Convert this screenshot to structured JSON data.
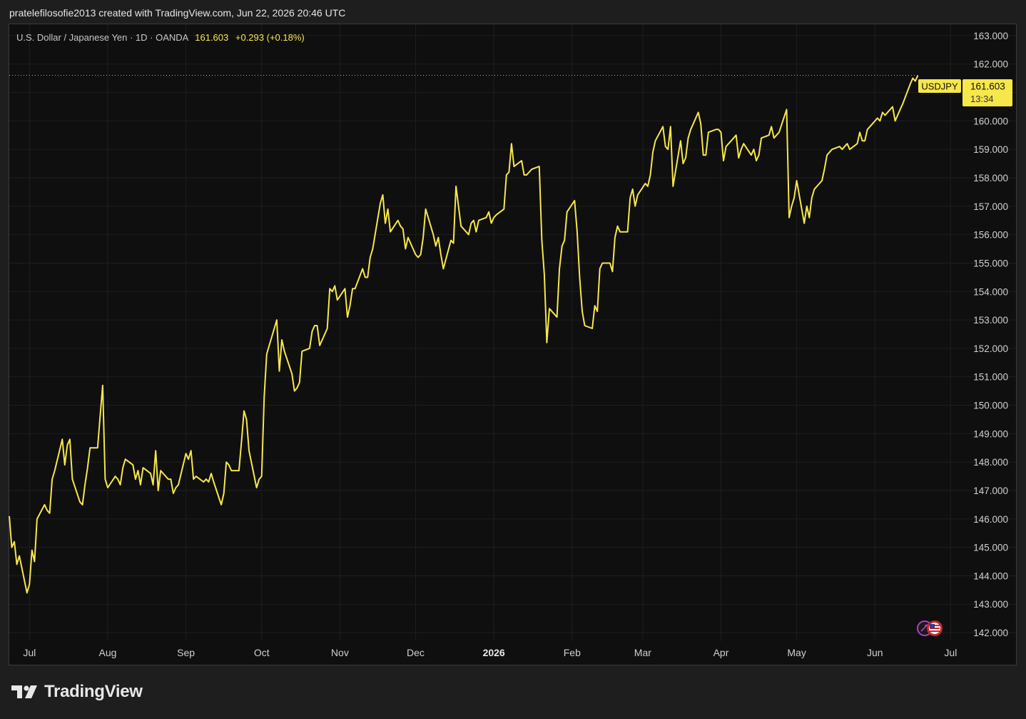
{
  "header": {
    "text": "pratelefilosofie2013 created with TradingView.com, Jun 22, 2026 20:46 UTC"
  },
  "legend": {
    "symbol_text": "U.S. Dollar / Japanese Yen · 1D · OANDA",
    "last": "161.603",
    "change": "+0.293 (+0.18%)"
  },
  "price_label": {
    "symbol": "USDJPY",
    "price": "161.603",
    "countdown": "13:34"
  },
  "brand": {
    "name": "TradingView"
  },
  "colors": {
    "line": "#f6e74a",
    "background": "#0f0f0f",
    "page": "#1e1e1e",
    "grid": "#1f1f1f"
  },
  "icons": [
    "tradingview-logo-icon",
    "us-flag-icon",
    "events-icon"
  ],
  "chart_data": {
    "type": "line",
    "title": "U.S. Dollar / Japanese Yen · 1D · OANDA",
    "series_name": "USDJPY",
    "ylim": [
      141.7,
      163.4
    ],
    "y_ticks": [
      "163.000",
      "162.000",
      "161.000",
      "160.000",
      "159.000",
      "158.000",
      "157.000",
      "156.000",
      "155.000",
      "154.000",
      "153.000",
      "152.000",
      "151.000",
      "150.000",
      "149.000",
      "148.000",
      "147.000",
      "146.000",
      "145.000",
      "144.000",
      "143.000",
      "142.000"
    ],
    "x_ticks": [
      {
        "label": "Jul",
        "date": "2025-07-01"
      },
      {
        "label": "Aug",
        "date": "2025-08-01"
      },
      {
        "label": "Sep",
        "date": "2025-09-01"
      },
      {
        "label": "Oct",
        "date": "2025-10-01"
      },
      {
        "label": "Nov",
        "date": "2025-11-01"
      },
      {
        "label": "Dec",
        "date": "2025-12-01"
      },
      {
        "label": "2026",
        "date": "2026-01-01",
        "bold": true
      },
      {
        "label": "Feb",
        "date": "2026-02-01"
      },
      {
        "label": "Mar",
        "date": "2026-03-01"
      },
      {
        "label": "Apr",
        "date": "2026-04-01"
      },
      {
        "label": "May",
        "date": "2026-05-01"
      },
      {
        "label": "Jun",
        "date": "2026-06-01"
      },
      {
        "label": "Jul",
        "date": "2026-07-01"
      }
    ],
    "x_range": [
      "2025-06-23",
      "2026-07-04"
    ],
    "grid": true,
    "points": [
      [
        "2025-06-23",
        146.1
      ],
      [
        "2025-06-24",
        145.0
      ],
      [
        "2025-06-25",
        145.2
      ],
      [
        "2025-06-26",
        144.4
      ],
      [
        "2025-06-27",
        144.7
      ],
      [
        "2025-06-30",
        143.4
      ],
      [
        "2025-07-01",
        143.7
      ],
      [
        "2025-07-02",
        144.9
      ],
      [
        "2025-07-03",
        144.5
      ],
      [
        "2025-07-04",
        146.0
      ],
      [
        "2025-07-07",
        146.5
      ],
      [
        "2025-07-08",
        146.3
      ],
      [
        "2025-07-09",
        146.2
      ],
      [
        "2025-07-10",
        147.4
      ],
      [
        "2025-07-11",
        147.7
      ],
      [
        "2025-07-14",
        148.8
      ],
      [
        "2025-07-15",
        147.9
      ],
      [
        "2025-07-16",
        148.6
      ],
      [
        "2025-07-17",
        148.8
      ],
      [
        "2025-07-18",
        147.4
      ],
      [
        "2025-07-21",
        146.6
      ],
      [
        "2025-07-22",
        146.5
      ],
      [
        "2025-07-23",
        147.2
      ],
      [
        "2025-07-24",
        147.8
      ],
      [
        "2025-07-25",
        148.5
      ],
      [
        "2025-07-28",
        148.5
      ],
      [
        "2025-07-29",
        149.6
      ],
      [
        "2025-07-30",
        150.7
      ],
      [
        "2025-07-31",
        147.4
      ],
      [
        "2025-08-01",
        147.1
      ],
      [
        "2025-08-04",
        147.5
      ],
      [
        "2025-08-05",
        147.4
      ],
      [
        "2025-08-06",
        147.2
      ],
      [
        "2025-08-07",
        147.8
      ],
      [
        "2025-08-08",
        148.1
      ],
      [
        "2025-08-11",
        147.9
      ],
      [
        "2025-08-12",
        147.4
      ],
      [
        "2025-08-13",
        147.7
      ],
      [
        "2025-08-14",
        147.2
      ],
      [
        "2025-08-15",
        147.8
      ],
      [
        "2025-08-18",
        147.6
      ],
      [
        "2025-08-19",
        147.2
      ],
      [
        "2025-08-20",
        148.4
      ],
      [
        "2025-08-21",
        147.0
      ],
      [
        "2025-08-22",
        147.7
      ],
      [
        "2025-08-25",
        147.4
      ],
      [
        "2025-08-26",
        147.4
      ],
      [
        "2025-08-27",
        146.9
      ],
      [
        "2025-08-28",
        147.1
      ],
      [
        "2025-08-29",
        147.2
      ],
      [
        "2025-09-01",
        148.3
      ],
      [
        "2025-09-02",
        148.1
      ],
      [
        "2025-09-03",
        148.4
      ],
      [
        "2025-09-04",
        147.4
      ],
      [
        "2025-09-05",
        147.5
      ],
      [
        "2025-09-08",
        147.3
      ],
      [
        "2025-09-09",
        147.4
      ],
      [
        "2025-09-10",
        147.3
      ],
      [
        "2025-09-11",
        147.6
      ],
      [
        "2025-09-12",
        147.3
      ],
      [
        "2025-09-15",
        146.5
      ],
      [
        "2025-09-16",
        146.9
      ],
      [
        "2025-09-17",
        148.0
      ],
      [
        "2025-09-18",
        147.9
      ],
      [
        "2025-09-19",
        147.7
      ],
      [
        "2025-09-22",
        147.7
      ],
      [
        "2025-09-23",
        148.7
      ],
      [
        "2025-09-24",
        149.8
      ],
      [
        "2025-09-25",
        149.5
      ],
      [
        "2025-09-26",
        148.4
      ],
      [
        "2025-09-29",
        147.1
      ],
      [
        "2025-09-30",
        147.4
      ],
      [
        "2025-10-01",
        147.5
      ],
      [
        "2025-10-02",
        150.3
      ],
      [
        "2025-10-03",
        151.8
      ],
      [
        "2025-10-06",
        152.7
      ],
      [
        "2025-10-07",
        153.0
      ],
      [
        "2025-10-08",
        151.2
      ],
      [
        "2025-10-09",
        152.3
      ],
      [
        "2025-10-10",
        151.9
      ],
      [
        "2025-10-13",
        151.1
      ],
      [
        "2025-10-14",
        150.5
      ],
      [
        "2025-10-15",
        150.6
      ],
      [
        "2025-10-16",
        150.8
      ],
      [
        "2025-10-17",
        151.9
      ],
      [
        "2025-10-20",
        152.0
      ],
      [
        "2025-10-21",
        152.6
      ],
      [
        "2025-10-22",
        152.8
      ],
      [
        "2025-10-23",
        152.8
      ],
      [
        "2025-10-24",
        152.1
      ],
      [
        "2025-10-27",
        152.7
      ],
      [
        "2025-10-28",
        154.1
      ],
      [
        "2025-10-29",
        154.0
      ],
      [
        "2025-10-30",
        154.2
      ],
      [
        "2025-10-31",
        153.7
      ],
      [
        "2025-11-03",
        154.1
      ],
      [
        "2025-11-04",
        153.1
      ],
      [
        "2025-11-05",
        153.5
      ],
      [
        "2025-11-06",
        154.1
      ],
      [
        "2025-11-07",
        154.1
      ],
      [
        "2025-11-10",
        154.8
      ],
      [
        "2025-11-11",
        154.5
      ],
      [
        "2025-11-12",
        154.5
      ],
      [
        "2025-11-13",
        155.2
      ],
      [
        "2025-11-14",
        155.5
      ],
      [
        "2025-11-17",
        157.1
      ],
      [
        "2025-11-18",
        157.4
      ],
      [
        "2025-11-19",
        156.4
      ],
      [
        "2025-11-20",
        156.9
      ],
      [
        "2025-11-21",
        156.1
      ],
      [
        "2025-11-24",
        156.5
      ],
      [
        "2025-11-25",
        156.3
      ],
      [
        "2025-11-26",
        156.2
      ],
      [
        "2025-11-27",
        155.5
      ],
      [
        "2025-11-28",
        155.9
      ],
      [
        "2025-12-01",
        155.3
      ],
      [
        "2025-12-02",
        155.2
      ],
      [
        "2025-12-03",
        155.3
      ],
      [
        "2025-12-04",
        155.9
      ],
      [
        "2025-12-05",
        156.9
      ],
      [
        "2025-12-08",
        156.0
      ],
      [
        "2025-12-09",
        155.6
      ],
      [
        "2025-12-10",
        155.9
      ],
      [
        "2025-12-11",
        155.3
      ],
      [
        "2025-12-12",
        154.8
      ],
      [
        "2025-12-15",
        155.8
      ],
      [
        "2025-12-16",
        155.7
      ],
      [
        "2025-12-17",
        157.7
      ],
      [
        "2025-12-18",
        157.0
      ],
      [
        "2025-12-19",
        156.3
      ],
      [
        "2025-12-22",
        156.0
      ],
      [
        "2025-12-23",
        156.4
      ],
      [
        "2025-12-24",
        156.5
      ],
      [
        "2025-12-25",
        156.1
      ],
      [
        "2025-12-26",
        156.5
      ],
      [
        "2025-12-29",
        156.6
      ],
      [
        "2025-12-30",
        156.8
      ],
      [
        "2025-12-31",
        156.4
      ],
      [
        "2026-01-01",
        156.6
      ],
      [
        "2026-01-02",
        156.7
      ],
      [
        "2026-01-05",
        156.9
      ],
      [
        "2026-01-06",
        158.1
      ],
      [
        "2026-01-07",
        158.2
      ],
      [
        "2026-01-08",
        159.2
      ],
      [
        "2026-01-09",
        158.4
      ],
      [
        "2026-01-12",
        158.6
      ],
      [
        "2026-01-13",
        158.1
      ],
      [
        "2026-01-14",
        158.1
      ],
      [
        "2026-01-15",
        158.2
      ],
      [
        "2026-01-16",
        158.3
      ],
      [
        "2026-01-19",
        158.4
      ],
      [
        "2026-01-20",
        155.8
      ],
      [
        "2026-01-21",
        154.6
      ],
      [
        "2026-01-22",
        152.2
      ],
      [
        "2026-01-23",
        153.4
      ],
      [
        "2026-01-26",
        153.1
      ],
      [
        "2026-01-27",
        154.8
      ],
      [
        "2026-01-28",
        155.6
      ],
      [
        "2026-01-29",
        155.8
      ],
      [
        "2026-01-30",
        156.8
      ],
      [
        "2026-02-02",
        157.2
      ],
      [
        "2026-02-03",
        156.1
      ],
      [
        "2026-02-04",
        154.5
      ],
      [
        "2026-02-05",
        153.3
      ],
      [
        "2026-02-06",
        152.8
      ],
      [
        "2026-02-09",
        152.7
      ],
      [
        "2026-02-10",
        153.5
      ],
      [
        "2026-02-11",
        153.3
      ],
      [
        "2026-02-12",
        154.8
      ],
      [
        "2026-02-13",
        155.0
      ],
      [
        "2026-02-16",
        155.0
      ],
      [
        "2026-02-17",
        154.7
      ],
      [
        "2026-02-18",
        155.9
      ],
      [
        "2026-02-19",
        156.3
      ],
      [
        "2026-02-20",
        156.1
      ],
      [
        "2026-02-23",
        156.1
      ],
      [
        "2026-02-24",
        157.3
      ],
      [
        "2026-02-25",
        157.6
      ],
      [
        "2026-02-26",
        157.0
      ],
      [
        "2026-02-27",
        157.4
      ],
      [
        "2026-03-02",
        157.8
      ],
      [
        "2026-03-03",
        157.7
      ],
      [
        "2026-03-04",
        158.1
      ],
      [
        "2026-03-05",
        158.9
      ],
      [
        "2026-03-06",
        159.3
      ],
      [
        "2026-03-09",
        159.8
      ],
      [
        "2026-03-10",
        159.1
      ],
      [
        "2026-03-11",
        159.0
      ],
      [
        "2026-03-12",
        159.8
      ],
      [
        "2026-03-13",
        157.7
      ],
      [
        "2026-03-16",
        159.3
      ],
      [
        "2026-03-17",
        158.5
      ],
      [
        "2026-03-18",
        158.7
      ],
      [
        "2026-03-19",
        159.4
      ],
      [
        "2026-03-20",
        159.7
      ],
      [
        "2026-03-23",
        160.3
      ],
      [
        "2026-03-24",
        159.9
      ],
      [
        "2026-03-25",
        158.8
      ],
      [
        "2026-03-26",
        158.8
      ],
      [
        "2026-03-27",
        159.6
      ],
      [
        "2026-03-30",
        159.7
      ],
      [
        "2026-03-31",
        159.7
      ],
      [
        "2026-04-01",
        159.6
      ],
      [
        "2026-04-02",
        158.6
      ],
      [
        "2026-04-03",
        159.1
      ],
      [
        "2026-04-06",
        159.4
      ],
      [
        "2026-04-07",
        159.5
      ],
      [
        "2026-04-08",
        158.7
      ],
      [
        "2026-04-09",
        159.0
      ],
      [
        "2026-04-10",
        159.2
      ],
      [
        "2026-04-13",
        158.8
      ],
      [
        "2026-04-14",
        159.0
      ],
      [
        "2026-04-15",
        158.6
      ],
      [
        "2026-04-16",
        158.8
      ],
      [
        "2026-04-17",
        159.4
      ],
      [
        "2026-04-20",
        159.5
      ],
      [
        "2026-04-21",
        159.8
      ],
      [
        "2026-04-22",
        159.4
      ],
      [
        "2026-04-23",
        159.5
      ],
      [
        "2026-04-24",
        159.6
      ],
      [
        "2026-04-27",
        160.4
      ],
      [
        "2026-04-28",
        156.6
      ],
      [
        "2026-04-29",
        157.0
      ],
      [
        "2026-04-30",
        157.3
      ],
      [
        "2026-05-01",
        157.9
      ],
      [
        "2026-05-04",
        156.4
      ],
      [
        "2026-05-05",
        157.0
      ],
      [
        "2026-05-06",
        156.6
      ],
      [
        "2026-05-07",
        157.3
      ],
      [
        "2026-05-08",
        157.6
      ],
      [
        "2026-05-11",
        157.9
      ],
      [
        "2026-05-12",
        158.3
      ],
      [
        "2026-05-13",
        158.8
      ],
      [
        "2026-05-14",
        158.9
      ],
      [
        "2026-05-15",
        159.0
      ],
      [
        "2026-05-18",
        159.1
      ],
      [
        "2026-05-19",
        159.0
      ],
      [
        "2026-05-20",
        159.1
      ],
      [
        "2026-05-21",
        159.2
      ],
      [
        "2026-05-22",
        159.0
      ],
      [
        "2026-05-25",
        159.2
      ],
      [
        "2026-05-26",
        159.6
      ],
      [
        "2026-05-27",
        159.3
      ],
      [
        "2026-05-28",
        159.3
      ],
      [
        "2026-05-29",
        159.7
      ],
      [
        "2026-06-01",
        160.0
      ],
      [
        "2026-06-02",
        160.1
      ],
      [
        "2026-06-03",
        160.0
      ],
      [
        "2026-06-04",
        160.3
      ],
      [
        "2026-06-05",
        160.2
      ],
      [
        "2026-06-08",
        160.5
      ],
      [
        "2026-06-09",
        160.0
      ],
      [
        "2026-06-10",
        160.2
      ],
      [
        "2026-06-11",
        160.4
      ],
      [
        "2026-06-12",
        160.6
      ],
      [
        "2026-06-15",
        161.3
      ],
      [
        "2026-06-16",
        161.5
      ],
      [
        "2026-06-17",
        161.4
      ],
      [
        "2026-06-18",
        161.6
      ]
    ]
  }
}
